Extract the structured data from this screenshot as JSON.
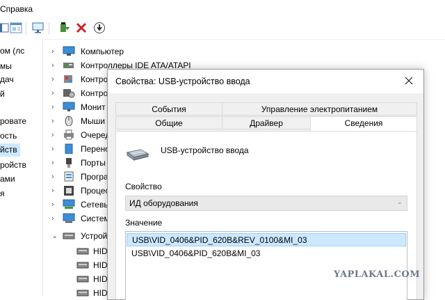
{
  "menubar": {
    "help_label": "Справка"
  },
  "left_pane": {
    "items": [
      "ом (лс",
      "мы",
      "дач",
      "й",
      "ровате",
      "ость",
      "йств",
      "ройств",
      "ами",
      "я"
    ],
    "selected_index": 6
  },
  "tree": {
    "categories": [
      {
        "label": "Компьютер",
        "icon": "computer-icon"
      },
      {
        "label": "Контроллеры IDE ATA/ATAPI",
        "icon": "ide-controller-icon"
      },
      {
        "label": "Контро",
        "icon": "storage-controller-icon"
      },
      {
        "label": "Контро",
        "icon": "controller-gear-icon"
      },
      {
        "label": "Монит",
        "icon": "monitor-icon"
      },
      {
        "label": "Мыши",
        "icon": "mouse-icon"
      },
      {
        "label": "Очеред",
        "icon": "print-queue-icon"
      },
      {
        "label": "Перено",
        "icon": "portable-device-icon"
      },
      {
        "label": "Порты",
        "icon": "port-icon"
      },
      {
        "label": "Програ",
        "icon": "software-device-icon"
      },
      {
        "label": "Процес",
        "icon": "processor-icon"
      },
      {
        "label": "Сетевы",
        "icon": "network-adapter-icon"
      },
      {
        "label": "Систем",
        "icon": "system-device-icon"
      },
      {
        "label": "Устрой",
        "icon": "hid-device-icon"
      }
    ],
    "children": [
      "HID",
      "HID",
      "HID",
      "HID"
    ]
  },
  "dialog": {
    "title": "Свойства: USB-устройство ввода",
    "tabs_row1": [
      "События",
      "Управление электропитанием"
    ],
    "tabs_row2": [
      "Общие",
      "Драйвер",
      "Сведения"
    ],
    "active_tab": "Сведения",
    "device_name": "USB-устройство ввода",
    "property_label": "Свойство",
    "property_value": "ИД оборудования",
    "value_label": "Значение",
    "values": [
      "USB\\VID_0406&PID_620B&REV_0100&MI_03",
      "USB\\VID_0406&PID_620B&MI_03"
    ]
  },
  "watermark": "YAPLAKAL.COM",
  "colors": {
    "selection": "#cce8ff",
    "dialog_bg": "#f0f0f0"
  }
}
